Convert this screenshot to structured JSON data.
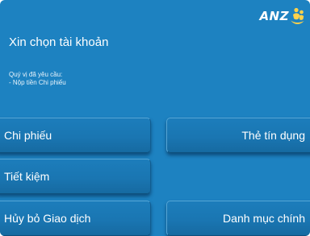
{
  "brand": {
    "logo_text": "ANZ",
    "logo_icon": "anz-people-icon",
    "screen_color": "#1d82c1"
  },
  "screen": {
    "title": "Xin chọn tài khoản",
    "request_label": "Quý vị đã yêu cầu:",
    "request_item": "- Nộp tiền Chi phiếu"
  },
  "options": {
    "cheque": "Chi phiếu",
    "credit_card": "Thẻ tín dụng",
    "savings": "Tiết kiệm",
    "cancel": "Hủy bỏ Giao dịch",
    "main_menu": "Danh mục chính"
  }
}
